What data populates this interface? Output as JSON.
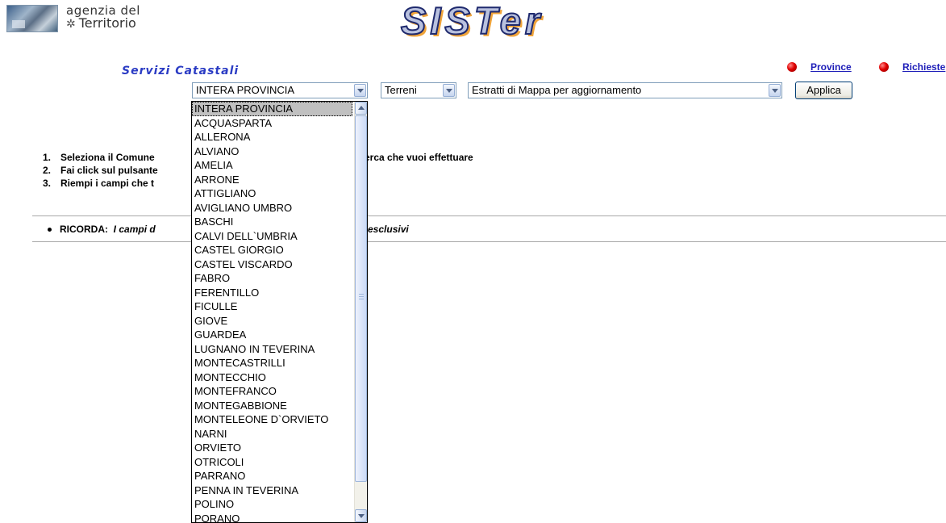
{
  "header": {
    "agency_line1": "agenzia del",
    "agency_line2": "Territorio",
    "app_logo": "SISTer",
    "section_title": "Servizi Catastali",
    "nav": [
      {
        "label": "Province",
        "icon": "red-bullet-icon"
      },
      {
        "label": "Richieste",
        "icon": "red-bullet-icon"
      }
    ]
  },
  "form": {
    "comune_value": "INTERA PROVINCIA",
    "catasto_value": "Terreni",
    "service_value": "Estratti di Mappa per aggiornamento",
    "apply_label": "Applica"
  },
  "instructions": [
    {
      "num": "1.",
      "text": "Seleziona il Comune"
    },
    {
      "num": "2.",
      "text": "Fai click sul pulsante"
    },
    {
      "num": "3.",
      "text": "Riempi i campi che t"
    }
  ],
  "instruction_tail": "icerca che vuoi effettuare",
  "remember": {
    "label": "RICORDA:",
    "text": "I campi d",
    "tail": "te esclusivi"
  },
  "dropdown": {
    "selected_index": 0,
    "options": [
      "INTERA PROVINCIA",
      "ACQUASPARTA",
      "ALLERONA",
      "ALVIANO",
      "AMELIA",
      "ARRONE",
      "ATTIGLIANO",
      "AVIGLIANO UMBRO",
      "BASCHI",
      "CALVI DELL`UMBRIA",
      "CASTEL GIORGIO",
      "CASTEL VISCARDO",
      "FABRO",
      "FERENTILLO",
      "FICULLE",
      "GIOVE",
      "GUARDEA",
      "LUGNANO IN TEVERINA",
      "MONTECASTRILLI",
      "MONTECCHIO",
      "MONTEFRANCO",
      "MONTEGABBIONE",
      "MONTELEONE D`ORVIETO",
      "NARNI",
      "ORVIETO",
      "OTRICOLI",
      "PARRANO",
      "PENNA IN TEVERINA",
      "POLINO",
      "PORANO"
    ]
  }
}
